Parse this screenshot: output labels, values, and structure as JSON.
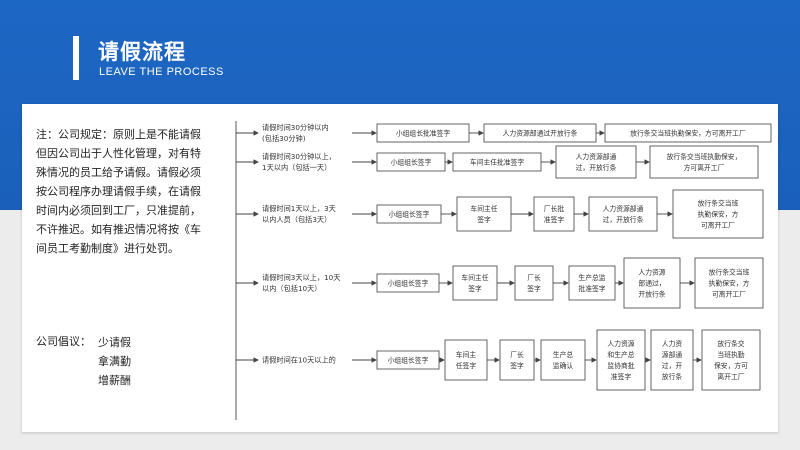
{
  "header": {
    "title": "请假流程",
    "subtitle": "LEAVE THE PROCESS"
  },
  "note": {
    "lines": [
      "注：公司规定：原则上是不能请假",
      "但因公司出于人性化管理，对有特",
      "殊情况的员工给予请假。请假必须",
      "按公司程序办理请假手续，在请假",
      "时间内必须回到工厂，只准提前，",
      "不许推迟。如有推迟情况将按《车",
      "间员工考勤制度》进行处罚。"
    ]
  },
  "proposal": {
    "label": "公司倡议：",
    "items": [
      "少请假",
      "拿满勤",
      "增薪酬"
    ]
  },
  "flow": {
    "rows": [
      {
        "condition": [
          "请假时间30分钟以内",
          "(包括30分钟)"
        ],
        "steps": [
          [
            "小组组长批准签字"
          ],
          [
            "人力资源部通过开放行条"
          ],
          [
            "放行条交当班执勤保安，方可离开工厂"
          ]
        ]
      },
      {
        "condition": [
          "请假时间30分钟以上，",
          "1天以内（包括一天）"
        ],
        "steps": [
          [
            "小组组长签字"
          ],
          [
            "车间主任批准签字"
          ],
          [
            "人力资源部通",
            "过，开放行条"
          ],
          [
            "放行条交当班执勤保安，",
            "方可离开工厂"
          ]
        ]
      },
      {
        "condition": [
          "请假时间1天以上，3天",
          "以内人员（包括3天）"
        ],
        "steps": [
          [
            "小组组长签字"
          ],
          [
            "车间主任",
            "签字"
          ],
          [
            "厂长批",
            "准签字"
          ],
          [
            "人力资源部通",
            "过，开放行条"
          ],
          [
            "放行条交当班",
            "执勤保安，方",
            "可离开工厂"
          ]
        ]
      },
      {
        "condition": [
          "请假时间3天以上，10天",
          "以内（包括10天）"
        ],
        "steps": [
          [
            "小组组长签字"
          ],
          [
            "车间主任",
            "签字"
          ],
          [
            "厂长",
            "签字"
          ],
          [
            "生产总监",
            "批准签字"
          ],
          [
            "人力资源",
            "部通过，",
            "开放行条"
          ],
          [
            "放行条交当班",
            "执勤保安，方",
            "可离开工厂"
          ]
        ]
      },
      {
        "condition": [
          "请假时间在10天以上的"
        ],
        "steps": [
          [
            "小组组长签字"
          ],
          [
            "车间主",
            "任签字"
          ],
          [
            "厂长",
            "签字"
          ],
          [
            "生产总",
            "监确认"
          ],
          [
            "人力资源",
            "和生产总",
            "监协商批",
            "准签字"
          ],
          [
            "人力资",
            "源部通",
            "过，开",
            "放行条"
          ],
          [
            "放行条交",
            "当班执勤",
            "保安，方可",
            "离开工厂"
          ]
        ]
      }
    ]
  },
  "colors": {
    "header_blue": "#1d67c4",
    "band_grey": "#ececec",
    "card_white": "#ffffff"
  }
}
